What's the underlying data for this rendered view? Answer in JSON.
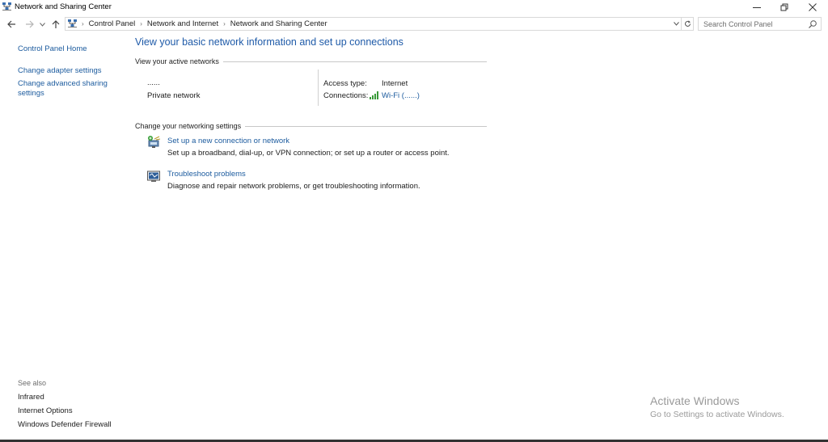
{
  "window": {
    "title": "Network and Sharing Center"
  },
  "address_bar": {
    "breadcrumbs": [
      "Control Panel",
      "Network and Internet",
      "Network and Sharing Center"
    ]
  },
  "search": {
    "placeholder": "Search Control Panel"
  },
  "left_nav": {
    "home": "Control Panel Home",
    "items": [
      "Change adapter settings",
      "Change advanced sharing settings"
    ],
    "see_also_label": "See also",
    "see_also": [
      "Infrared",
      "Internet Options",
      "Windows Defender Firewall"
    ]
  },
  "main": {
    "heading": "View your basic network information and set up connections",
    "active_networks_label": "View your active networks",
    "network": {
      "name": "......",
      "type": "Private network",
      "access_type_label": "Access type:",
      "access_type_value": "Internet",
      "connections_label": "Connections:",
      "connection_name": "Wi-Fi (......)"
    },
    "change_settings_label": "Change your networking settings",
    "tasks": [
      {
        "title": "Set up a new connection or network",
        "description": "Set up a broadband, dial-up, or VPN connection; or set up a router or access point."
      },
      {
        "title": "Troubleshoot problems",
        "description": "Diagnose and repair network problems, or get troubleshooting information."
      }
    ]
  },
  "watermark": {
    "title": "Activate Windows",
    "subtitle": "Go to Settings to activate Windows."
  }
}
